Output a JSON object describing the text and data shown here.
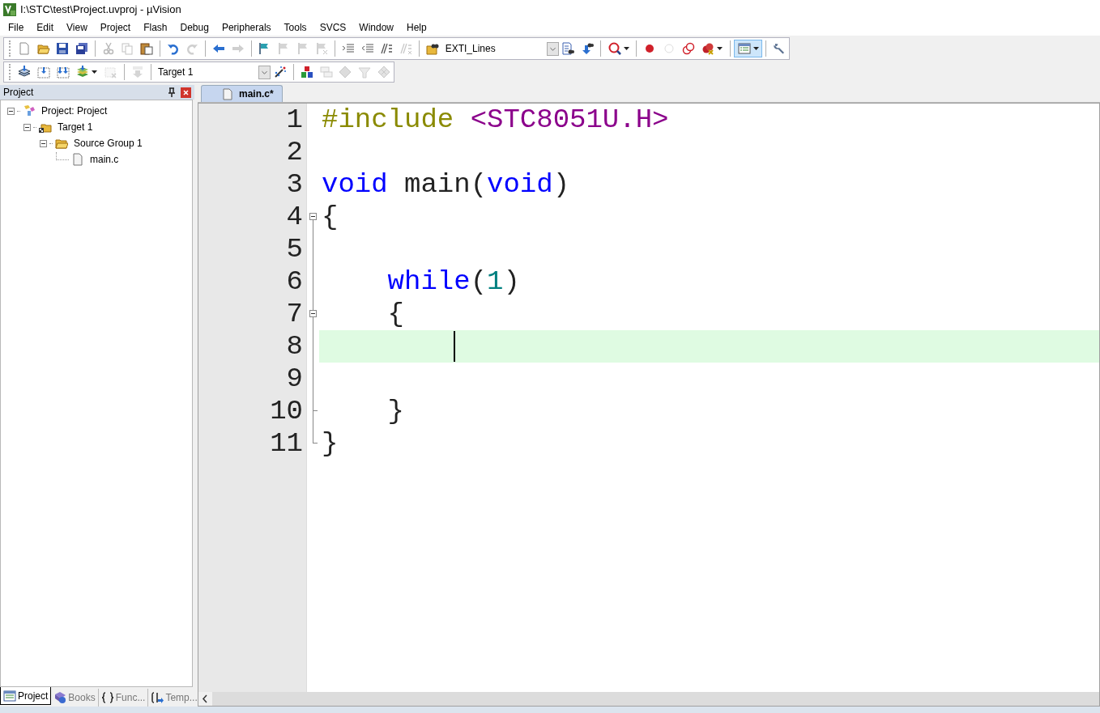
{
  "window": {
    "title": "I:\\STC\\test\\Project.uvproj - µVision"
  },
  "menu": [
    "File",
    "Edit",
    "View",
    "Project",
    "Flash",
    "Debug",
    "Peripherals",
    "Tools",
    "SVCS",
    "Window",
    "Help"
  ],
  "toolbars": [
    {
      "items": [
        {
          "kind": "button",
          "disabled": false,
          "pressed": false,
          "dropdown": false
        },
        {
          "kind": "button",
          "disabled": false,
          "pressed": false,
          "dropdown": false
        },
        {
          "kind": "button",
          "disabled": false,
          "pressed": false,
          "dropdown": false
        },
        {
          "kind": "button",
          "disabled": false,
          "pressed": false,
          "dropdown": false
        },
        {
          "kind": "separator"
        },
        {
          "kind": "button",
          "disabled": true,
          "pressed": false,
          "dropdown": false
        },
        {
          "kind": "button",
          "disabled": true,
          "pressed": false,
          "dropdown": false
        },
        {
          "kind": "button",
          "disabled": false,
          "pressed": false,
          "dropdown": false
        },
        {
          "kind": "separator"
        },
        {
          "kind": "button",
          "disabled": false,
          "pressed": false,
          "dropdown": false
        },
        {
          "kind": "button",
          "disabled": true,
          "pressed": false,
          "dropdown": false
        },
        {
          "kind": "separator"
        },
        {
          "kind": "button",
          "disabled": false,
          "pressed": false,
          "dropdown": false
        },
        {
          "kind": "button",
          "disabled": true,
          "pressed": false,
          "dropdown": false
        },
        {
          "kind": "separator"
        },
        {
          "kind": "button",
          "disabled": false,
          "pressed": false,
          "dropdown": false
        },
        {
          "kind": "button",
          "disabled": true,
          "pressed": false,
          "dropdown": false
        },
        {
          "kind": "button",
          "disabled": true,
          "pressed": false,
          "dropdown": false
        },
        {
          "kind": "button",
          "disabled": true,
          "pressed": false,
          "dropdown": false
        },
        {
          "kind": "separator"
        },
        {
          "kind": "button",
          "disabled": false,
          "pressed": false,
          "dropdown": false
        },
        {
          "kind": "button",
          "disabled": false,
          "pressed": false,
          "dropdown": false
        },
        {
          "kind": "button",
          "disabled": false,
          "pressed": false,
          "dropdown": false
        },
        {
          "kind": "button",
          "disabled": true,
          "pressed": false,
          "dropdown": false
        },
        {
          "kind": "separator"
        },
        {
          "kind": "button",
          "disabled": false,
          "pressed": false,
          "dropdown": false
        },
        {
          "kind": "combo",
          "value": "EXTI_Lines"
        },
        {
          "kind": "button",
          "disabled": false,
          "pressed": false,
          "dropdown": false
        },
        {
          "kind": "button",
          "disabled": false,
          "pressed": false,
          "dropdown": false
        },
        {
          "kind": "separator"
        },
        {
          "kind": "button",
          "disabled": false,
          "pressed": false,
          "dropdown": true
        },
        {
          "kind": "separator"
        },
        {
          "kind": "button",
          "disabled": false,
          "pressed": false,
          "dropdown": false
        },
        {
          "kind": "button",
          "disabled": true,
          "pressed": false,
          "dropdown": false
        },
        {
          "kind": "button",
          "disabled": false,
          "pressed": false,
          "dropdown": false
        },
        {
          "kind": "button",
          "disabled": false,
          "pressed": false,
          "dropdown": true
        },
        {
          "kind": "separator"
        },
        {
          "kind": "button",
          "disabled": false,
          "pressed": true,
          "dropdown": true
        },
        {
          "kind": "separator"
        },
        {
          "kind": "button",
          "disabled": false,
          "pressed": false,
          "dropdown": false
        }
      ]
    },
    {
      "items": [
        {
          "kind": "button",
          "disabled": false,
          "pressed": false,
          "dropdown": false
        },
        {
          "kind": "button",
          "disabled": false,
          "pressed": false,
          "dropdown": false
        },
        {
          "kind": "button",
          "disabled": false,
          "pressed": false,
          "dropdown": false
        },
        {
          "kind": "button",
          "disabled": false,
          "pressed": false,
          "dropdown": true
        },
        {
          "kind": "button",
          "disabled": true,
          "pressed": false,
          "dropdown": false
        },
        {
          "kind": "separator"
        },
        {
          "kind": "button",
          "disabled": true,
          "pressed": false,
          "dropdown": false
        },
        {
          "kind": "separator"
        },
        {
          "kind": "combo",
          "value": "Target 1"
        },
        {
          "kind": "button",
          "disabled": false,
          "pressed": false,
          "dropdown": false
        },
        {
          "kind": "separator"
        },
        {
          "kind": "button",
          "disabled": false,
          "pressed": false,
          "dropdown": false
        },
        {
          "kind": "button",
          "disabled": true,
          "pressed": false,
          "dropdown": false
        },
        {
          "kind": "button",
          "disabled": true,
          "pressed": false,
          "dropdown": false
        },
        {
          "kind": "button",
          "disabled": true,
          "pressed": false,
          "dropdown": false
        },
        {
          "kind": "button",
          "disabled": true,
          "pressed": false,
          "dropdown": false
        }
      ]
    }
  ],
  "project_panel": {
    "title": "Project",
    "tree": [
      {
        "kind": "project",
        "label": "Project: Project",
        "expanded": true,
        "children": [
          {
            "kind": "target",
            "label": "Target 1",
            "expanded": true,
            "children": [
              {
                "kind": "group",
                "label": "Source Group 1",
                "expanded": true,
                "children": [
                  {
                    "kind": "file",
                    "label": "main.c"
                  }
                ]
              }
            ]
          }
        ]
      }
    ],
    "tabs": [
      {
        "label": "Project",
        "selected": true
      },
      {
        "label": "Books",
        "selected": false
      },
      {
        "label": "Func...",
        "selected": false
      },
      {
        "label": "Temp...",
        "selected": false
      }
    ]
  },
  "editor": {
    "tabs": [
      {
        "label": "main.c*",
        "selected": true
      }
    ],
    "lines": [
      {
        "kind": "line",
        "number": "1",
        "current": false,
        "tokens": [
          {
            "kind": "preprocessor",
            "text": "#include"
          },
          {
            "kind": "header",
            "text": " <STC8051U.H>"
          }
        ]
      },
      {
        "kind": "line",
        "number": "2",
        "current": false
      },
      {
        "kind": "line",
        "number": "3",
        "current": false,
        "tokens": [
          {
            "kind": "keyword",
            "text": "void"
          },
          {
            "kind": "plain",
            "text": " main("
          },
          {
            "kind": "keyword",
            "text": "void"
          },
          {
            "kind": "plain",
            "text": ")"
          }
        ]
      },
      {
        "kind": "fold_start",
        "number": "4",
        "current": false,
        "tokens": [
          {
            "kind": "plain",
            "text": "{"
          }
        ]
      },
      {
        "kind": "line",
        "number": "5",
        "current": false
      },
      {
        "kind": "line",
        "number": "6",
        "current": false,
        "tokens": [
          {
            "kind": "keyword",
            "text": "    while"
          },
          {
            "kind": "plain",
            "text": "("
          },
          {
            "kind": "number",
            "text": "1"
          },
          {
            "kind": "plain",
            "text": ")"
          }
        ]
      },
      {
        "kind": "fold_start",
        "number": "7",
        "current": false,
        "tokens": [
          {
            "kind": "plain",
            "text": "    {"
          }
        ]
      },
      {
        "kind": "line",
        "number": "8",
        "current": true
      },
      {
        "kind": "line",
        "number": "9",
        "current": false
      },
      {
        "kind": "fold_end",
        "number": "10",
        "current": false,
        "tokens": [
          {
            "kind": "plain",
            "text": "    }"
          }
        ]
      },
      {
        "kind": "fold_end",
        "number": "11",
        "current": false,
        "tokens": [
          {
            "kind": "plain",
            "text": "}"
          }
        ]
      }
    ]
  }
}
